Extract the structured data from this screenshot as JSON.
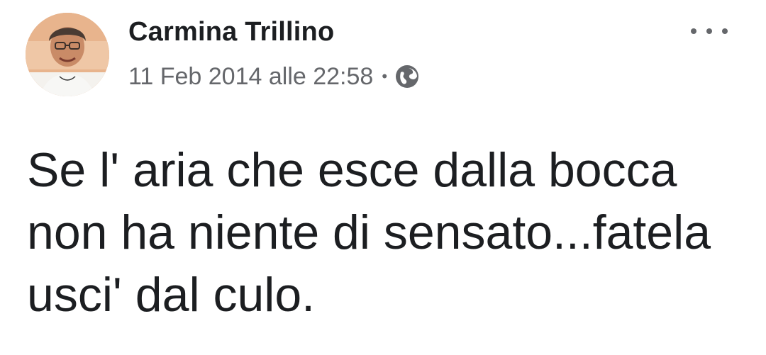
{
  "post": {
    "author": {
      "name": "Carmina Trillino",
      "avatar_icon": "profile-photo"
    },
    "meta": {
      "timestamp": "11 Feb 2014 alle 22:58",
      "separator": "•",
      "privacy_icon": "globe-icon"
    },
    "more_options_icon": "more-horizontal-icon",
    "text_lines": [
      "Se l' aria che esce dalla bocca",
      "non ha niente di sensato...fatela",
      "usci' dal culo."
    ]
  },
  "colors": {
    "name": "#1c1e21",
    "meta": "#65676b",
    "background": "#ffffff"
  }
}
